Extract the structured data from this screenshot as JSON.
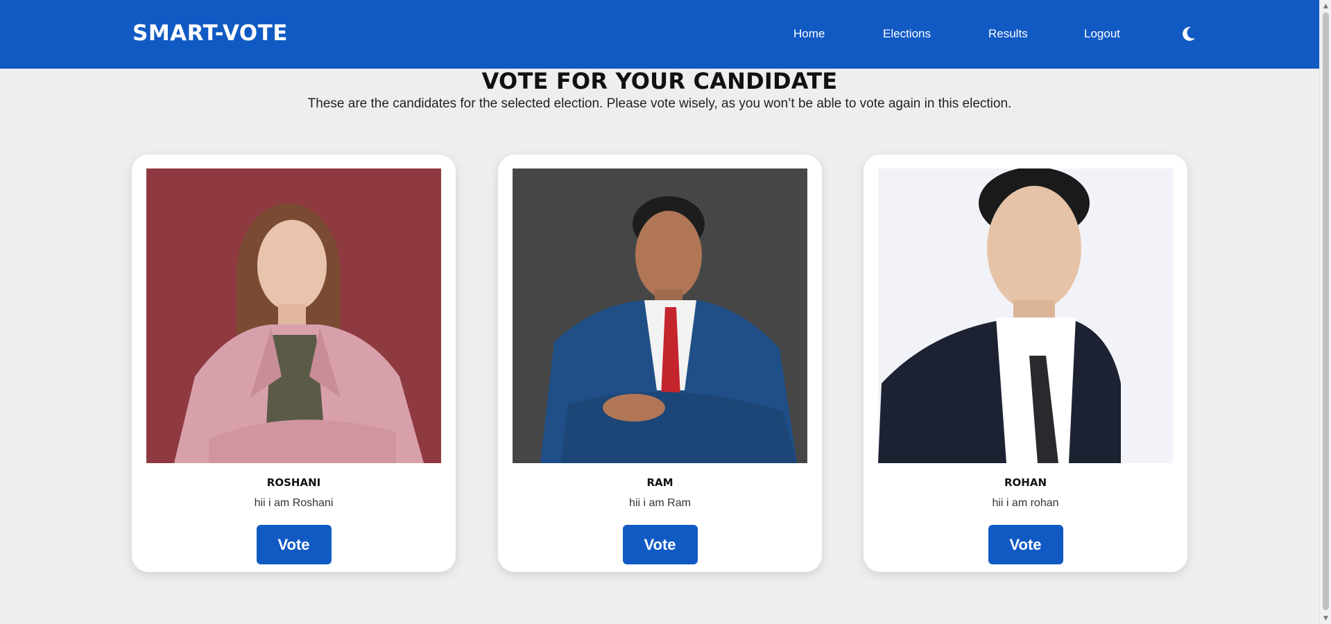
{
  "navbar": {
    "brand": "SMART-VOTE",
    "links": [
      "Home",
      "Elections",
      "Results",
      "Logout"
    ],
    "theme_icon": "moon-icon",
    "background": "#115ac4"
  },
  "main": {
    "title": "VOTE FOR YOUR CANDIDATE",
    "subtitle": "These are the candidates for the selected election. Please vote wisely, as you won’t be able to vote again in this election."
  },
  "candidates": [
    {
      "name": "ROSHANI",
      "description": "hii i am Roshani",
      "vote_label": "Vote",
      "photo_bg": "#8e3a40"
    },
    {
      "name": "RAM",
      "description": "hii i am Ram",
      "vote_label": "Vote",
      "photo_bg": "#464646"
    },
    {
      "name": "ROHAN",
      "description": "hii i am rohan",
      "vote_label": "Vote",
      "photo_bg": "#f2f3f9"
    }
  ],
  "colors": {
    "accent": "#115ac4",
    "page_bg": "#efeeee",
    "card_bg": "#ffffff"
  }
}
